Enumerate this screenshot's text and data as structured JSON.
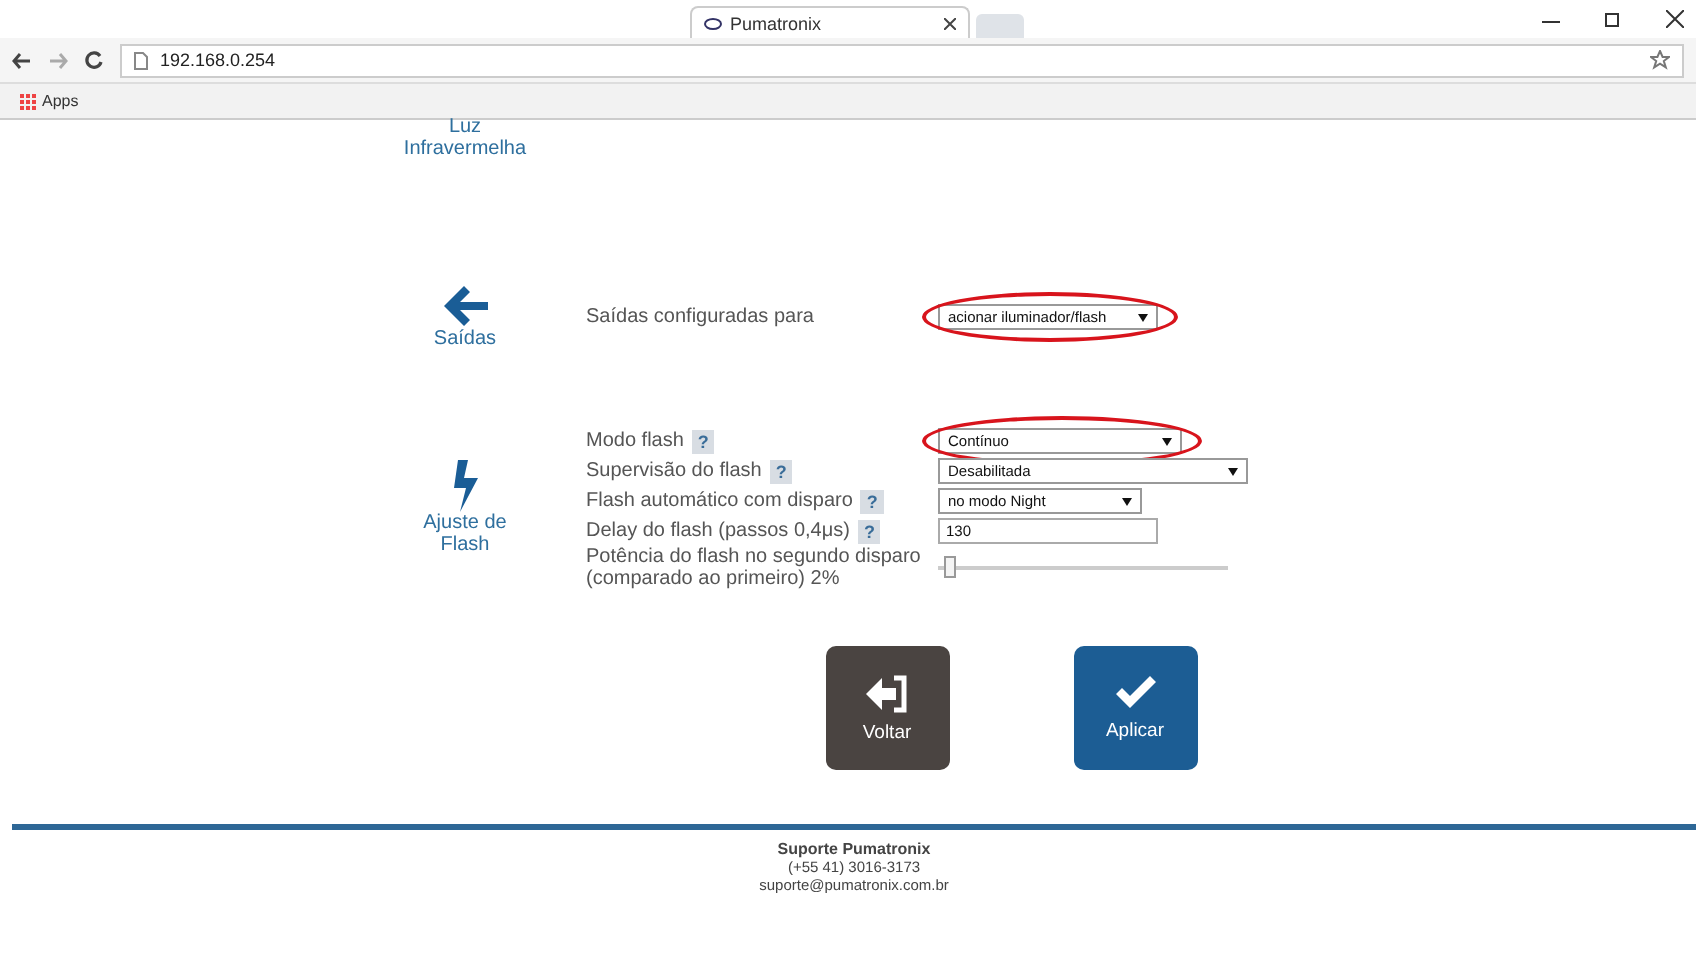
{
  "browser": {
    "tab_title": "Pumatronix",
    "url": "192.168.0.254",
    "bookmarks": [
      "Apps"
    ]
  },
  "sections": [
    {
      "kind": "infrared",
      "label_lines": [
        "Luz",
        "Infravermelha"
      ]
    },
    {
      "kind": "outputs",
      "label_lines": [
        "Saídas"
      ],
      "rows": [
        {
          "kind": "select",
          "label": "Saídas configuradas para",
          "value": "acionar iluminador/flash",
          "annotated": true
        }
      ]
    },
    {
      "kind": "flash",
      "label_lines": [
        "Ajuste de",
        "Flash"
      ],
      "rows": [
        {
          "kind": "select",
          "label": "Modo flash",
          "help": "?",
          "value": "Contínuo",
          "annotated": true
        },
        {
          "kind": "select",
          "label": "Supervisão do flash",
          "help": "?",
          "value": "Desabilitada",
          "annotated": false
        },
        {
          "kind": "select",
          "label": "Flash automático com disparo",
          "help": "?",
          "value": "no modo Night",
          "annotated": false
        },
        {
          "kind": "text",
          "label": "Delay do flash (passos 0,4μs)",
          "help": "?",
          "value": "130",
          "annotated": false
        },
        {
          "kind": "slider",
          "label": "Potência do flash no segundo disparo (comparado ao primeiro) 2%",
          "level": 0.02,
          "annotated": false
        }
      ]
    }
  ],
  "buttons": [
    {
      "kind": "back",
      "label": "Voltar"
    },
    {
      "kind": "apply",
      "label": "Aplicar"
    }
  ],
  "footer": {
    "title": "Suporte Pumatronix",
    "phone": "(+55 41) 3016-3173",
    "email": "suporte@pumatronix.com.br"
  }
}
